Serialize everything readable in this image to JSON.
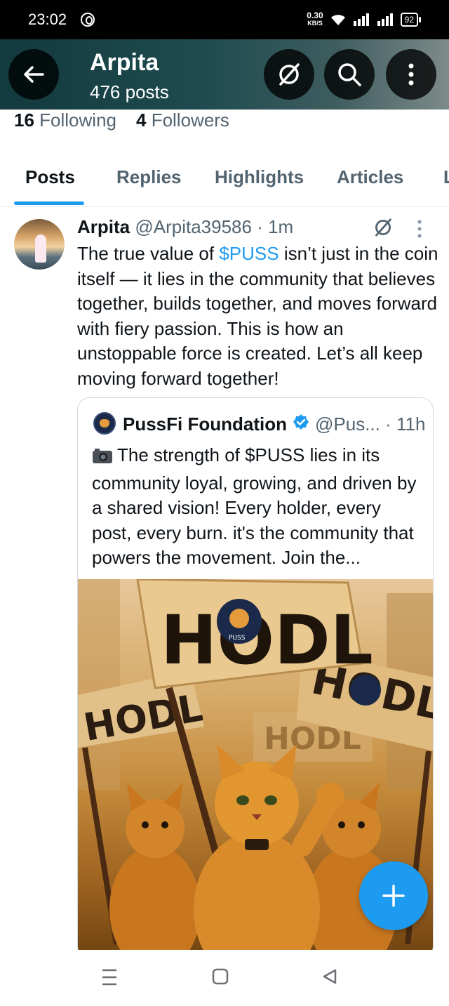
{
  "status_bar": {
    "time": "23:02",
    "net_speed_value": "0.30",
    "net_speed_unit": "KB/S",
    "battery": "92"
  },
  "header": {
    "name": "Arpita",
    "posts_count": "476 posts"
  },
  "profile": {
    "following_count": "16",
    "following_label": "Following",
    "followers_count": "4",
    "followers_label": "Followers"
  },
  "tabs": [
    "Posts",
    "Replies",
    "Highlights",
    "Articles",
    "L"
  ],
  "active_tab": "Posts",
  "post": {
    "author": "Arpita",
    "handle": "@Arpita39586",
    "time": "· 1m",
    "text_before": "The true value of ",
    "cashtag": "$PUSS",
    "text_after": " isn’t just in the coin itself — it lies in the community that believes together, builds together, and moves forward with fiery passion. This is how an unstoppable force is created. Let’s all keep moving forward together!"
  },
  "quote": {
    "name": "PussFi Foundation",
    "handle": "@Pus...",
    "time": "· 11h",
    "text": "The strength of $PUSS lies in its community loyal, growing, and driven by a shared vision! Every holder, every post, every burn. it's the community that powers the movement. Join the...",
    "image_sign_text": "HODL",
    "image_badge_text": "PUSS"
  },
  "colors": {
    "accent": "#1d9bf0",
    "text_primary": "#0f1419",
    "text_secondary": "#536471",
    "header_gradient_start": "#133a3e"
  },
  "icons": [
    "back-arrow-icon",
    "slash-circle-icon",
    "search-icon",
    "more-vertical-icon",
    "verified-badge-icon",
    "camera-icon",
    "plus-icon",
    "menu-lines-icon",
    "home-square-icon",
    "back-triangle-icon"
  ]
}
